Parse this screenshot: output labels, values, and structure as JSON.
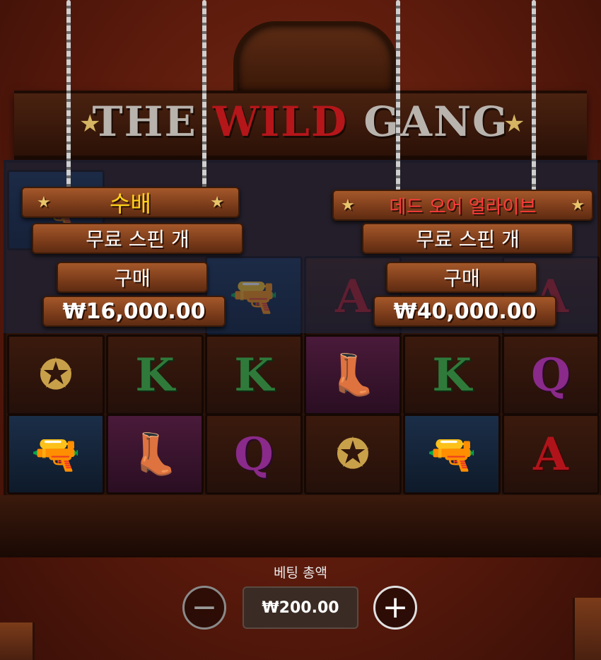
{
  "game": {
    "title_prefix": "THE ",
    "title_wild": "WILD",
    "title_suffix": " GANG"
  },
  "buy_left": {
    "name": "수배",
    "line1": "무료 스핀 개",
    "line2": "구매",
    "price": "₩16,000.00"
  },
  "buy_right": {
    "name": "데드 오어 얼라이브",
    "line1": "무료 스핀 개",
    "line2": "구매",
    "price": "₩40,000.00"
  },
  "bet": {
    "label": "베팅 총액",
    "value": "₩200.00",
    "minus": "−",
    "plus": "+"
  },
  "reels": {
    "row3": [
      "sheriff-badge-icon",
      "K",
      "K",
      "boots-icon",
      "K",
      "Q"
    ],
    "row4": [
      "revolver-icon",
      "boots-icon",
      "Q",
      "sheriff-badge-icon",
      "revolver-icon",
      "A"
    ]
  },
  "symbols": {
    "K": "K",
    "Q": "Q",
    "A": "A",
    "star": "★"
  }
}
